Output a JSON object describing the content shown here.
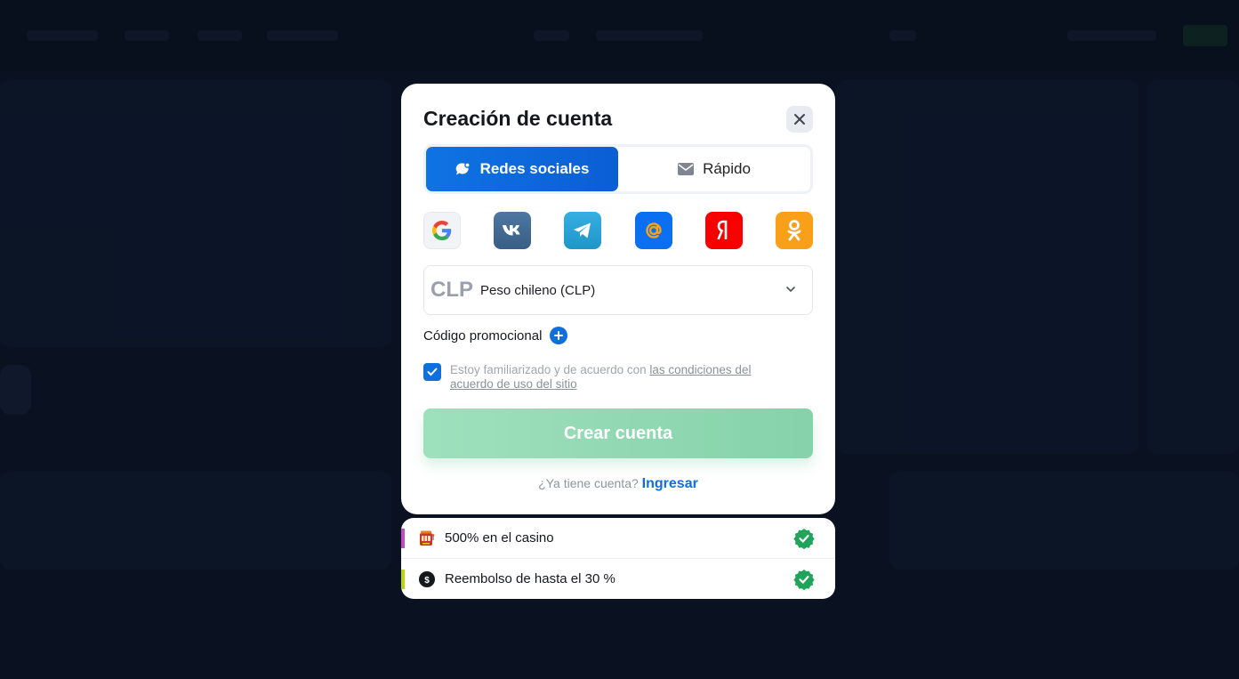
{
  "modal": {
    "title": "Creación de cuenta",
    "tabs": [
      {
        "label": "Redes sociales",
        "icon": "chat-bubble-icon",
        "active": true
      },
      {
        "label": "Rápido",
        "icon": "envelope-icon",
        "active": false
      }
    ],
    "socials": [
      {
        "name": "google",
        "icon": "google-icon",
        "color": "#f1f3f6"
      },
      {
        "name": "vk",
        "icon": "vk-icon",
        "color": "#466c93"
      },
      {
        "name": "telegram",
        "icon": "telegram-icon",
        "color": "#2aa3e0"
      },
      {
        "name": "mail",
        "icon": "at-sign-icon",
        "color": "#0a6ff0"
      },
      {
        "name": "yandex",
        "icon": "yandex-icon",
        "color": "#f70000"
      },
      {
        "name": "odnoklassniki",
        "icon": "ok-icon",
        "color": "#f9a01b"
      }
    ],
    "currency": {
      "code": "CLP",
      "name": "Peso chileno (CLP)"
    },
    "promo_label": "Código promocional",
    "agreement": {
      "checked": true,
      "text": "Estoy familiarizado y de acuerdo con ",
      "link": "las condiciones del acuerdo de uso del sitio"
    },
    "create_button": "Crear cuenta",
    "login_prompt": "¿Ya tiene cuenta?",
    "login_link": "Ingresar"
  },
  "bonuses": [
    {
      "text": "500% en el casino",
      "icon": "slot-machine-icon",
      "accent": "#c447c8"
    },
    {
      "text": "Reembolso de hasta el 30 %",
      "icon": "cashback-icon",
      "accent": "#b8d50e"
    }
  ],
  "colors": {
    "primary": "#0f6fdd",
    "success": "#1fa45a",
    "button": "#93dbb5"
  }
}
